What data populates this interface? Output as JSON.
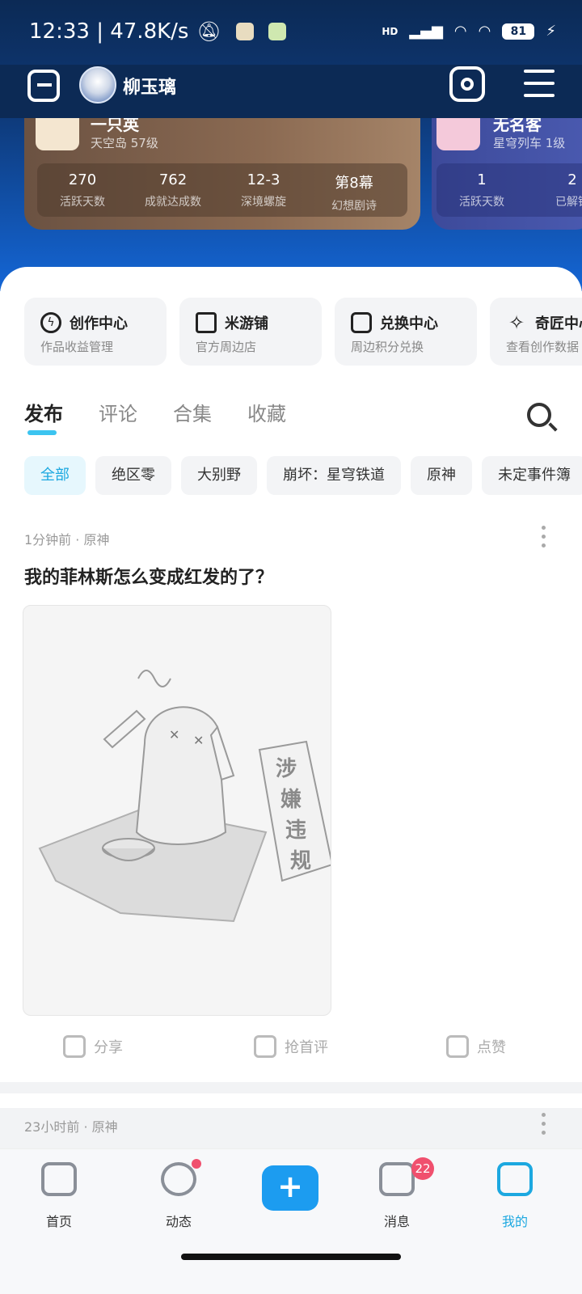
{
  "status_bar": {
    "time_speed": "12:33 | 47.8K/s",
    "battery": "81",
    "signal_label": "HD"
  },
  "nav": {
    "username": "柳玉璃"
  },
  "game_cards": [
    {
      "name": "一只英",
      "meta": "天空岛 57级",
      "stats": [
        {
          "value": "270",
          "label": "活跃天数"
        },
        {
          "value": "762",
          "label": "成就达成数"
        },
        {
          "value": "12-3",
          "label": "深境螺旋"
        },
        {
          "value": "第8幕",
          "label": "幻想剧诗"
        }
      ]
    },
    {
      "name": "无名客",
      "meta": "星穹列车 1级",
      "stats": [
        {
          "value": "1",
          "label": "活跃天数"
        },
        {
          "value": "2",
          "label": "已解锁"
        }
      ]
    }
  ],
  "shortcuts": [
    {
      "title": "创作中心",
      "subtitle": "作品收益管理",
      "icon": "lightning-icon"
    },
    {
      "title": "米游铺",
      "subtitle": "官方周边店",
      "icon": "cart-icon"
    },
    {
      "title": "兑换中心",
      "subtitle": "周边积分兑换",
      "icon": "shop-icon"
    },
    {
      "title": "奇匠中心",
      "subtitle": "查看创作数据",
      "icon": "sparkle-icon"
    }
  ],
  "tabs": [
    "发布",
    "评论",
    "合集",
    "收藏"
  ],
  "active_tab": "发布",
  "filters": [
    "全部",
    "绝区零",
    "大别野",
    "崩坏：星穹铁道",
    "原神",
    "未定事件簿"
  ],
  "posts": [
    {
      "meta": "1分钟前 · 原神",
      "title": "我的菲林斯怎么变成红发的了？",
      "image_sign_text": "涉嫌违规"
    },
    {
      "meta": "23小时前 · 原神"
    }
  ],
  "post_actions": {
    "share": "分享",
    "comment": "抢首评",
    "like": "点赞"
  },
  "bottom_nav": [
    {
      "label": "首页",
      "icon": "home-icon"
    },
    {
      "label": "动态",
      "icon": "compass-icon"
    },
    {
      "label": "消息",
      "icon": "message-icon",
      "badge": "22"
    },
    {
      "label": "我的",
      "icon": "profile-icon"
    }
  ],
  "colors": {
    "accent": "#1ca8e0",
    "header_dark": "#0c2a55",
    "badge": "#f0506e",
    "plus_button": "#1c9cf0"
  }
}
